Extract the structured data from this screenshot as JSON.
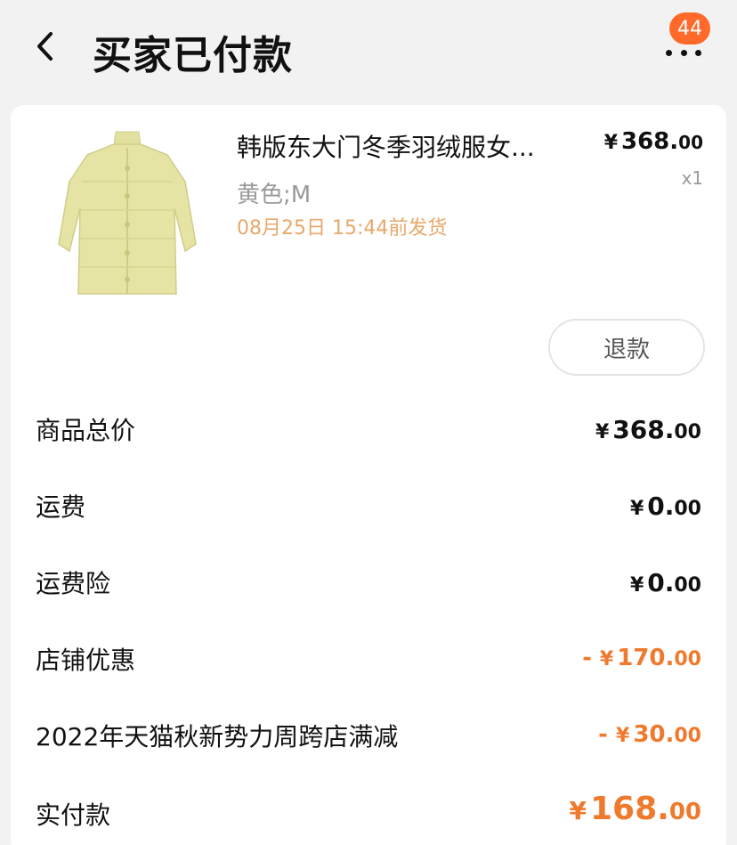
{
  "header": {
    "title": "买家已付款",
    "back_icon": "chevron-left-icon",
    "more_icon": "more-dots-icon",
    "badge_count": "44"
  },
  "colors": {
    "accent": "#ef7a2e",
    "badge": "#ff6a2b",
    "ship_time": "#e8a86a",
    "product_color": "#e6e4a4"
  },
  "product": {
    "title": "韩版东大门冬季羽绒服女...",
    "price_yen": "¥",
    "price_int": "368.",
    "price_cents": "00",
    "quantity": "x1",
    "spec": "黄色;M",
    "ship_time": "08月25日 15:44前发货",
    "refund_label": "退款"
  },
  "summary": {
    "rows": [
      {
        "label": "商品总价",
        "sign": "",
        "yen": "¥",
        "int": "368.",
        "cents": "00"
      },
      {
        "label": "运费",
        "sign": "",
        "yen": "¥",
        "int": "0.",
        "cents": "00"
      },
      {
        "label": "运费险",
        "sign": "",
        "yen": "¥",
        "int": "0.",
        "cents": "00"
      },
      {
        "label": "店铺优惠",
        "sign": "- ",
        "yen": "¥",
        "int": "170.",
        "cents": "00"
      },
      {
        "label": "2022年天猫秋新势力周跨店满减",
        "sign": "- ",
        "yen": "¥",
        "int": "30.",
        "cents": "00"
      },
      {
        "label": "实付款",
        "sign": "",
        "yen": "¥",
        "int": "168.",
        "cents": "00"
      }
    ]
  }
}
